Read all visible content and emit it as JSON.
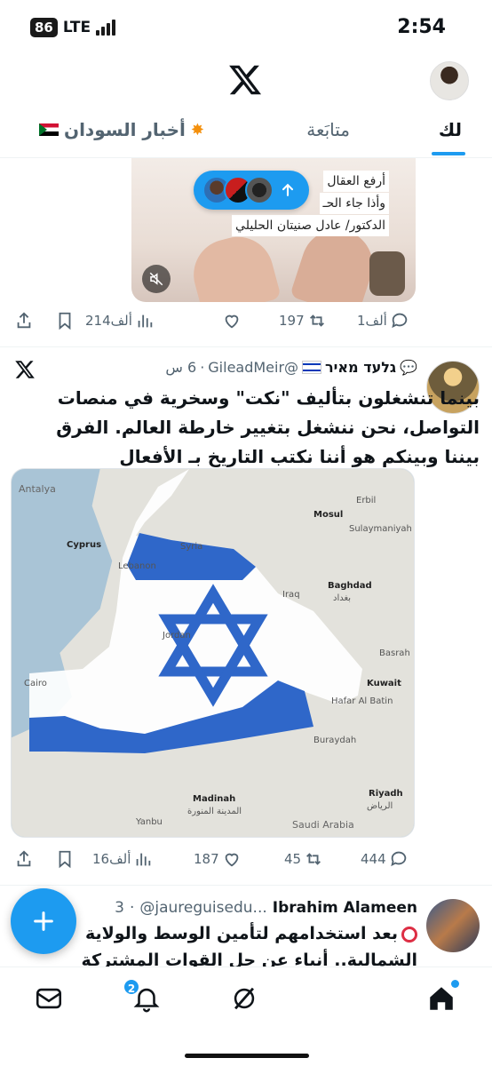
{
  "status_bar": {
    "battery": "86",
    "network": "LTE",
    "time": "2:54"
  },
  "header": {
    "logo": "x-logo",
    "avatar": "profile-avatar"
  },
  "tabs": {
    "for_you": "لك",
    "following": "متابَعة",
    "sudan_news": "أخبار السودان"
  },
  "post1": {
    "image_lines": [
      "أرفع العقال",
      "وأذا جاء الحـ",
      "الدكتور/ عادل صنيتان الحليلي"
    ],
    "actions": {
      "replies": "1ألف",
      "reposts": "197",
      "views": "214ألف"
    }
  },
  "new_posts_pill": {
    "icon": "arrow-up-icon"
  },
  "post2": {
    "name": "גלעד מאיר",
    "handle": "@GileadMeir",
    "time": "6 س",
    "text": "بينما تنشغلون بتأليف \"نكت\" وسخرية في منصات التواصل، نحن ننشغل بتغيير خارطة العالم. الفرق بيننا وبينكم هو أننا نكتب التاريخ بـ الأفعال",
    "map_labels": {
      "syria": "Syria",
      "lebanon": "Lebanon",
      "cyprus": "Cyprus",
      "jordan": "Jordan",
      "iraq": "Iraq",
      "baghdad": "Baghdad",
      "baghdad_ar": "بغداد",
      "basrah": "Basrah",
      "kuwait": "Kuwait",
      "riyadh": "Riyadh",
      "riyadh_ar": "الرياض",
      "saudi": "Saudi Arabia",
      "madinah": "Madinah",
      "madinah_ar": "المدينة المنورة",
      "antalya": "Antalya",
      "cairo": "Cairo",
      "mosul": "Mosul",
      "erbil": "Erbil",
      "sulaymaniyah": "Sulaymaniyah",
      "yanbu": "Yanbu",
      "hafar": "Hafar Al Batin",
      "buraydah": "Buraydah"
    },
    "actions": {
      "replies": "444",
      "reposts": "45",
      "likes": "187",
      "views": "16ألف"
    }
  },
  "post3": {
    "name": "Ibrahim Alameen",
    "handle": "@jaureguisedu...",
    "time": "3",
    "text": "بعد استخدامهم لتأمين الوسط والولاية الشمالية.. أنباء عن حل القوات المشتركة وإلغاء"
  },
  "bottom_nav": {
    "notifications_badge": "2"
  },
  "colors": {
    "accent": "#1d9bf0",
    "text": "#0f1419",
    "muted": "#536471"
  }
}
